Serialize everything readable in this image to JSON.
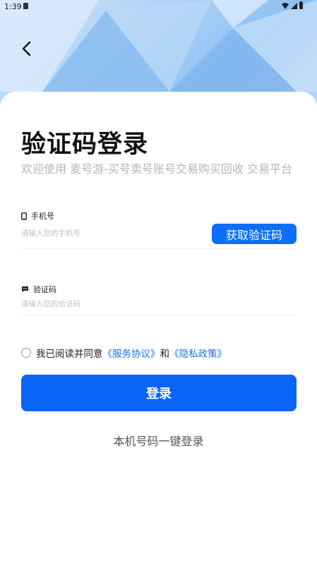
{
  "status_bar": {
    "time": "1:39"
  },
  "header": {
    "back_icon": "chevron-left-icon"
  },
  "page": {
    "title": "验证码登录",
    "subtitle": "欢迎使用 麦号游-买号卖号账号交易购买回收 交易平台"
  },
  "phone_field": {
    "label": "手机号",
    "icon": "phone-icon",
    "placeholder": "请输入您的手机号",
    "value": "",
    "get_code_label": "获取验证码"
  },
  "code_field": {
    "label": "验证码",
    "icon": "message-icon",
    "placeholder": "请输入您的验证码",
    "value": ""
  },
  "agreement": {
    "prefix": "我已阅读并同意",
    "service_link": "《服务协议》",
    "and": "和",
    "privacy_link": "《隐私政策》",
    "checked": false
  },
  "actions": {
    "login_label": "登录",
    "one_key_login_label": "本机号码一键登录"
  },
  "colors": {
    "primary": "#0a64f5",
    "link": "#1a73e8",
    "placeholder": "#c0c0c0",
    "subtitle": "#b5b5b5"
  }
}
